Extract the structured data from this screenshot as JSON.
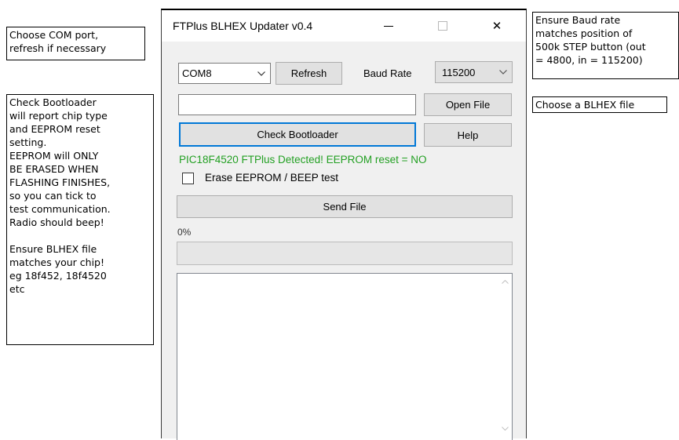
{
  "annotations": {
    "com_port": "Choose COM port,\nrefresh if necessary",
    "bootloader": "Check Bootloader\nwill report chip type\nand EEPROM reset\nsetting.\nEEPROM will ONLY\nBE ERASED WHEN\nFLASHING FINISHES,\nso you can tick to\ntest communication.\nRadio should beep!\n\nEnsure BLHEX file\nmatches your chip!\neg 18f452, 18f4520\netc",
    "baud_rate": "Ensure Baud rate\nmatches position of\n500k STEP button (out\n= 4800, in = 115200)",
    "blhex_file": "Choose a BLHEX file"
  },
  "window": {
    "title": "FTPlus BLHEX Updater v0.4",
    "close_glyph": "✕"
  },
  "form": {
    "com_port_value": "COM8",
    "refresh_label": "Refresh",
    "baud_rate_label": "Baud Rate",
    "baud_rate_value": "115200",
    "file_path_value": "",
    "open_file_label": "Open File",
    "check_bootloader_label": "Check Bootloader",
    "help_label": "Help",
    "detect_status": "PIC18F4520 FTPlus Detected! EEPROM reset = NO",
    "erase_eeprom_label": "Erase EEPROM / BEEP test",
    "erase_eeprom_checked": false,
    "send_file_label": "Send File",
    "progress_text": "0%",
    "progress_fraction": 0,
    "log_text": ""
  },
  "colors": {
    "status_green": "#23a023",
    "focus_blue": "#0078d7",
    "progress_green": "#06b025"
  },
  "icons": {
    "dropdown": "chevron-down-icon",
    "scroll_up": "chevron-up-icon",
    "scroll_down": "chevron-down-icon"
  }
}
